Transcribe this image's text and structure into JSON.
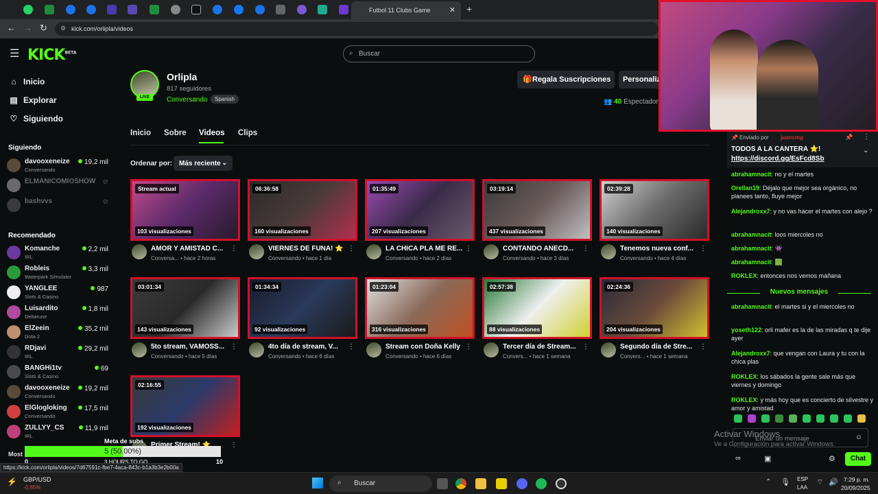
{
  "browser": {
    "active_tab_title": "Futbol 11 Clubs Game",
    "url": "kick.com/orlipla/videos",
    "status_url": "https://kick.com/orlipla/videos/7d67591c-fbe7-4aca-843c-b1a3b3e2b00a"
  },
  "header": {
    "logo": "KICK",
    "logo_beta": "BETA",
    "search_placeholder": "Buscar"
  },
  "sidebar": {
    "nav": [
      {
        "label": "Inicio",
        "icon": "home-icon"
      },
      {
        "label": "Explorar",
        "icon": "compass-icon"
      },
      {
        "label": "Siguiendo",
        "icon": "heart-icon"
      }
    ],
    "following_title": "Siguiendo",
    "following": [
      {
        "name": "davooxeneize",
        "category": "Conversando",
        "viewers": "19,2 mil",
        "live": true,
        "color": "#5a4a3a"
      },
      {
        "name": "ELMANICOMIOSHOW",
        "category": "",
        "viewers": "",
        "live": false,
        "color": "#6a6a6a"
      },
      {
        "name": "bashvvs",
        "category": "",
        "viewers": "",
        "live": false,
        "color": "#3a3a3a"
      }
    ],
    "recommended_title": "Recomendado",
    "recommended": [
      {
        "name": "Komanche",
        "category": "IRL",
        "viewers": "2,2 mil",
        "color": "#6a3aa0"
      },
      {
        "name": "Robleis",
        "category": "Waterpark Simulator",
        "viewers": "3,3 mil",
        "color": "#2a9a3a"
      },
      {
        "name": "YANGLEE",
        "category": "Slots & Casino",
        "viewers": "987",
        "color": "#eeeeee"
      },
      {
        "name": "Luisardito",
        "category": "Deltarune",
        "viewers": "1,8 mil",
        "color": "#b04aa0"
      },
      {
        "name": "ElZeein",
        "category": "Dota 2",
        "viewers": "35,2 mil",
        "color": "#c09070"
      },
      {
        "name": "RDjavi",
        "category": "IRL",
        "viewers": "29,2 mil",
        "color": "#333333"
      },
      {
        "name": "BANGHi1tv",
        "category": "Slots & Casino",
        "viewers": "69",
        "color": "#4a4a4a"
      },
      {
        "name": "davooxeneize",
        "category": "Conversando",
        "viewers": "19,2 mil",
        "color": "#5a4a3a"
      },
      {
        "name": "ElGlogloking",
        "category": "Conversando",
        "viewers": "17,5 mil",
        "color": "#d04040"
      },
      {
        "name": "ZULLYY_CS",
        "category": "IRL",
        "viewers": "11,9 mil",
        "color": "#c0407a"
      }
    ],
    "show_more": "Most"
  },
  "channel": {
    "name": "Orlipla",
    "followers": "817 seguidores",
    "category": "Conversando",
    "language": "Spanish",
    "live_badge": "LIVE",
    "gift_button": "Regala Suscripciones",
    "customize_button": "Personaliza",
    "viewers_count": "40",
    "viewers_label": "Espectadores"
  },
  "tabs": [
    "Inicio",
    "Sobre",
    "Videos",
    "Clips"
  ],
  "sort": {
    "label": "Ordenar por:",
    "value": "Más reciente"
  },
  "videos": [
    {
      "duration": "Stream actual",
      "views": "103 visualizaciones",
      "title": "AMOR Y AMISTAD C...",
      "category": "Conversa...",
      "age": "hace 2 horas",
      "bg": "linear-gradient(135deg,#c04a8a,#5a2a6a 50%,#2a1a2a)"
    },
    {
      "duration": "06:36:58",
      "views": "160 visualizaciones",
      "title": "VIERNES DE FUNA! ⭐",
      "category": "Conversando",
      "age": "hace 1 día",
      "bg": "linear-gradient(135deg,#2a2a2a,#4a3a3a 50%,#b03050)"
    },
    {
      "duration": "01:35:49",
      "views": "207 visualizaciones",
      "title": "LA CHICA PLA ME RE...",
      "category": "Conversando",
      "age": "hace 2 días",
      "bg": "linear-gradient(135deg,#9a4ab0,#3a2a4a 50%,#6a5a6a)"
    },
    {
      "duration": "03:19:14",
      "views": "437 visualizaciones",
      "title": "CONTANDO ANÉCD...",
      "category": "Conversando",
      "age": "hace 3 días",
      "bg": "linear-gradient(135deg,#3a3a3a,#6a5a5a 50%,#c0c0c0)"
    },
    {
      "duration": "02:39:28",
      "views": "140 visualizaciones",
      "title": "Tenemos nueva conf...",
      "category": "Conversando",
      "age": "hace 4 días",
      "bg": "linear-gradient(135deg,#d0d0d0,#6a6a6a 50%,#2a2a2a)"
    },
    {
      "duration": "03:01:34",
      "views": "143 visualizaciones",
      "title": "5to stream, VAMOSS...",
      "category": "Conversando",
      "age": "hace 5 días",
      "bg": "linear-gradient(135deg,#3a3a3a,#2a2a2a 50%,#cacaca)"
    },
    {
      "duration": "01:34:34",
      "views": "92 visualizaciones",
      "title": "4to día de stream, V...",
      "category": "Conversando",
      "age": "hace 6 días",
      "bg": "linear-gradient(135deg,#1a1a2a,#2a3a5a 50%,#1a1a1a)"
    },
    {
      "duration": "01:23:04",
      "views": "316 visualizaciones",
      "title": "Stream con Doña Kelly",
      "category": "Conversando",
      "age": "hace 6 días",
      "bg": "linear-gradient(135deg,#e0e0e0,#8a6a5a 50%,#c05020)"
    },
    {
      "duration": "02:57:38",
      "views": "88 visualizaciones",
      "title": "Tercer día de Stream...",
      "category": "Convers...",
      "age": "hace 1 semana",
      "bg": "linear-gradient(135deg,#2a7a3a,#f0f0f0 50%,#d0d030)"
    },
    {
      "duration": "02:24:36",
      "views": "204 visualizaciones",
      "title": "Segundo día de Stre...",
      "category": "Convers...",
      "age": "hace 1 semana",
      "bg": "linear-gradient(135deg,#2a2a3a,#6a4a3a 50%,#d0c030)"
    },
    {
      "duration": "02:16:55",
      "views": "192 visualizaciones",
      "title": "Primer Stream! ⭐",
      "category": "",
      "age": "",
      "bg": "linear-gradient(135deg,#3a3a3a,#2a3a6a 50%,#c02020)"
    }
  ],
  "chat": {
    "pinned_by": "Enviado por",
    "pinned_user": "juancmg",
    "pinned_text": "TODOS A LA CANTERA ⭐!",
    "pinned_link": "https://discord.gg/EsFcd8Sb",
    "messages": [
      {
        "user": "abrahamnacit",
        "color": "#53fc18",
        "text": "no y el martes"
      },
      {
        "user": "Orellan19",
        "color": "#53fc18",
        "text": "Déjalo que mejor sea orgánico, no planees tanto, fluye mejor"
      },
      {
        "user": "Alejandroxx7",
        "color": "#53fc18",
        "text": "y no vas hacer el martes con alejo ?"
      },
      {
        "user": "abrahamnacit",
        "color": "#53fc18",
        "text": "loos miercoles no"
      },
      {
        "user": "abrahamnacit",
        "color": "#53fc18",
        "text": "👾"
      },
      {
        "user": "abrahamnacit",
        "color": "#53fc18",
        "text": "🟩"
      },
      {
        "user": "ROKLEX",
        "color": "#53fc18",
        "text": "entonces nos vemos mañana"
      }
    ],
    "new_messages_label": "Nuevos mensajes",
    "new_messages": [
      {
        "user": "abrahamnacit",
        "color": "#53fc18",
        "text": "el martes si y el miercoles no"
      },
      {
        "user": "yoseth122",
        "color": "#53fc18",
        "text": "orli mafer es la de las miradas q te dije ayer"
      },
      {
        "user": "Alejandroxx7",
        "color": "#53fc18",
        "text": "que vengan con Laura y tu con la chica plas"
      },
      {
        "user": "ROKLEX",
        "color": "#53fc18",
        "text": "los sábados la gente sale más que viernes y domingo"
      },
      {
        "user": "ROKLEX",
        "color": "#53fc18",
        "text": "y más hoy que es concierto de silvestre y amor y amistad"
      }
    ],
    "input_placeholder": "Enviar un mensaje",
    "send_button": "Chat"
  },
  "overlay": {
    "goal_title": "Meta de subs",
    "goal_text": "5 (50.00%)",
    "goal_progress": 0.5,
    "goal_min": "0",
    "goal_max": "10",
    "goal_timer": "3 HOURS TO GO",
    "windows_watermark_title": "Activar Windows",
    "windows_watermark_sub": "Ve a Configuración para activar Windows."
  },
  "taskbar": {
    "ticker_name": "GBP/USD",
    "ticker_change": "-0,65%",
    "search": "Buscar",
    "lang": "ESP",
    "lang2": "LAA",
    "time": "7:29 p. m.",
    "date": "20/09/2025"
  }
}
